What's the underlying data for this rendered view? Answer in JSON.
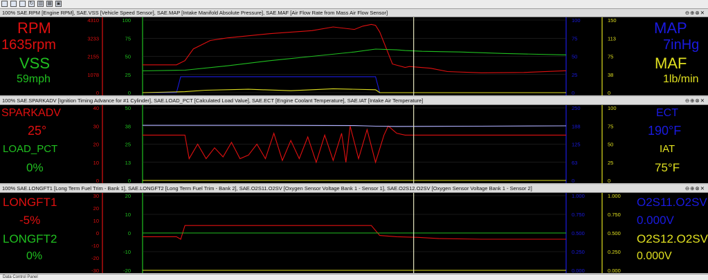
{
  "toolbar": {
    "icons": [
      "new-icon",
      "open-icon",
      "save-icon",
      "cycle-icon",
      "chart-icon",
      "grid-icon",
      "panel-icon"
    ]
  },
  "panels": [
    {
      "title": "100% SAE.RPM [Engine RPM], SAE.VSS [Vehicle Speed Sensor], SAE.MAP [Intake Manifold Absolute Pressure], SAE.MAF [Air Flow Rate from Mass Air Flow Sensor]",
      "controls": "⊖⊕⊗✕",
      "left": [
        {
          "text": "RPM",
          "color": "#e01010"
        },
        {
          "text": "1635rpm",
          "color": "#e01010"
        },
        {
          "text": "VSS",
          "color": "#20c020"
        },
        {
          "text": "59mph",
          "color": "#20c020"
        }
      ],
      "right": [
        {
          "text": "MAP",
          "color": "#1a1ae0"
        },
        {
          "text": "7inHg",
          "color": "#1a1ae0"
        },
        {
          "text": "MAF",
          "color": "#e0e020"
        },
        {
          "text": "1lb/min",
          "color": "#e0e020"
        }
      ]
    },
    {
      "title": "100% SAE.SPARKADV [Ignition Timing Advance for #1 Cylinder], SAE.LOAD_PCT [Calculated Load Value], SAE.ECT [Engine Coolant Temperature], SAE.IAT [Intake Air Temperature]",
      "controls": "⊖⊕⊗✕",
      "left": [
        {
          "text": "SPARKADV",
          "color": "#e01010"
        },
        {
          "text": "25°",
          "color": "#e01010"
        },
        {
          "text": "LOAD_PCT",
          "color": "#20c020"
        },
        {
          "text": "0%",
          "color": "#20c020"
        }
      ],
      "right": [
        {
          "text": "ECT",
          "color": "#1a1ae0"
        },
        {
          "text": "190°F",
          "color": "#1a1ae0"
        },
        {
          "text": "IAT",
          "color": "#e0e020"
        },
        {
          "text": "75°F",
          "color": "#e0e020"
        }
      ]
    },
    {
      "title": "100% SAE.LONGFT1 [Long Term Fuel Trim - Bank 1], SAE.LONGFT2 [Long Term Fuel Trim - Bank 2], SAE.O2S11.O2SV [Oxygen Sensor Voltage Bank 1 - Sensor 1], SAE.O2S12.O2SV [Oxygen Sensor Voltage Bank 1 - Sensor 2]",
      "controls": "⊖⊕⊗✕",
      "left": [
        {
          "text": "LONGFT1",
          "color": "#e01010"
        },
        {
          "text": "-5%",
          "color": "#e01010"
        },
        {
          "text": "LONGFT2",
          "color": "#20c020"
        },
        {
          "text": "0%",
          "color": "#20c020"
        }
      ],
      "right": [
        {
          "text": "O2S11.O2SV",
          "color": "#1a1ae0"
        },
        {
          "text": "0.000V",
          "color": "#1a1ae0"
        },
        {
          "text": "O2S12.O2SV",
          "color": "#e0e020"
        },
        {
          "text": "0.000V",
          "color": "#e0e020"
        }
      ]
    }
  ],
  "bottom_bar": {
    "label": "Data Control Panel"
  },
  "chart_data": [
    {
      "type": "line",
      "cursor_x": 64,
      "x_range": [
        0,
        100
      ],
      "axes": [
        {
          "side": "left-outer",
          "color": "#e01010",
          "ticks": [
            "0",
            "1078",
            "2155",
            "3233",
            "4310"
          ],
          "ylim": [
            0,
            4310
          ]
        },
        {
          "side": "left-inner",
          "color": "#20c020",
          "ticks": [
            "0",
            "25",
            "50",
            "75",
            "100"
          ],
          "ylim": [
            0,
            100
          ]
        },
        {
          "side": "right-inner",
          "color": "#1a1ae0",
          "ticks": [
            "0",
            "25",
            "50",
            "75",
            "100"
          ],
          "ylim": [
            0,
            100
          ]
        },
        {
          "side": "right-outer",
          "color": "#e0e020",
          "ticks": [
            "0",
            "38",
            "75",
            "113",
            "150"
          ],
          "ylim": [
            0,
            150
          ]
        }
      ],
      "series": [
        {
          "axis": 0,
          "color": "#e01010",
          "x": [
            0,
            8,
            10,
            12,
            16,
            20,
            30,
            40,
            45,
            50,
            52,
            54,
            55,
            56,
            59,
            62,
            63,
            68,
            72,
            80,
            90,
            100
          ],
          "y": [
            1650,
            1650,
            1900,
            2600,
            3100,
            3250,
            3500,
            3680,
            3900,
            3750,
            3950,
            4050,
            4000,
            3600,
            1700,
            1500,
            1550,
            1450,
            1250,
            1180,
            1200,
            1300
          ]
        },
        {
          "axis": 1,
          "color": "#20c020",
          "x": [
            0,
            10,
            20,
            30,
            40,
            50,
            55,
            60,
            62,
            66,
            75,
            85,
            100
          ],
          "y": [
            30,
            31,
            37,
            44,
            50,
            56,
            60,
            59,
            58,
            57,
            56,
            54,
            52
          ]
        },
        {
          "axis": 2,
          "color": "#1a1ae0",
          "x": [
            0,
            8,
            9,
            55,
            56,
            100
          ],
          "y": [
            0,
            0,
            22,
            22,
            0,
            0
          ]
        },
        {
          "axis": 3,
          "color": "#e0e020",
          "x": [
            0,
            10,
            15,
            25,
            35,
            45,
            55,
            56,
            100
          ],
          "y": [
            0,
            2,
            5,
            7,
            4,
            8,
            6,
            0,
            0
          ]
        }
      ]
    },
    {
      "type": "line",
      "cursor_x": 64,
      "x_range": [
        0,
        100
      ],
      "axes": [
        {
          "side": "left-outer",
          "color": "#e01010",
          "ticks": [
            "0",
            "10",
            "20",
            "30",
            "40"
          ],
          "ylim": [
            0,
            40
          ]
        },
        {
          "side": "left-inner",
          "color": "#20c020",
          "ticks": [
            "0",
            "13",
            "25",
            "38",
            "50"
          ],
          "ylim": [
            0,
            50
          ]
        },
        {
          "side": "right-inner",
          "color": "#1a1ae0",
          "ticks": [
            "0",
            "63",
            "125",
            "188",
            "250"
          ],
          "ylim": [
            0,
            250
          ]
        },
        {
          "side": "right-outer",
          "color": "#e0e020",
          "ticks": [
            "0",
            "25",
            "50",
            "75",
            "100"
          ],
          "ylim": [
            0,
            100
          ]
        }
      ],
      "series": [
        {
          "axis": 0,
          "color": "#e01010",
          "x": [
            0,
            8,
            10,
            11,
            13,
            15,
            17,
            19,
            21,
            23,
            25,
            27,
            29,
            31,
            33,
            35,
            37,
            39,
            41,
            43,
            45,
            47,
            48,
            49,
            51,
            53,
            55,
            57,
            58,
            60,
            62,
            64,
            66,
            70,
            80,
            90,
            100
          ],
          "y": [
            25,
            25,
            25,
            12,
            20,
            12,
            18,
            13,
            21,
            12,
            14,
            20,
            12,
            26,
            11,
            22,
            12,
            24,
            10,
            25,
            11,
            26,
            10,
            30,
            12,
            28,
            10,
            25,
            30,
            26,
            25,
            25,
            25,
            25,
            25,
            25,
            25
          ]
        },
        {
          "axis": 1,
          "color": "#20c020",
          "x": [
            0,
            100
          ],
          "y": [
            0,
            0
          ]
        },
        {
          "axis": 2,
          "color": "#b0b0ff",
          "x": [
            0,
            30,
            50,
            55,
            60,
            80,
            100
          ],
          "y": [
            190,
            190,
            189,
            187,
            186,
            187,
            188
          ]
        },
        {
          "axis": 3,
          "color": "#e0e020",
          "x": [
            0,
            100
          ],
          "y": [
            0,
            0
          ]
        }
      ]
    },
    {
      "type": "line",
      "cursor_x": 64,
      "x_range": [
        0,
        100
      ],
      "axes": [
        {
          "side": "left-outer",
          "color": "#e01010",
          "ticks": [
            "-30",
            "-20",
            "-10",
            "0",
            "10",
            "20",
            "30"
          ],
          "ylim": [
            -30,
            30
          ]
        },
        {
          "side": "left-inner",
          "color": "#20c020",
          "ticks": [
            "-20",
            "-10",
            "0",
            "10",
            "20"
          ],
          "ylim": [
            -20,
            20
          ]
        },
        {
          "side": "right-inner",
          "color": "#1a1ae0",
          "ticks": [
            "0.000",
            "0.250",
            "0.500",
            "0.750",
            "1.000"
          ],
          "ylim": [
            0,
            1
          ]
        },
        {
          "side": "right-outer",
          "color": "#e0e020",
          "ticks": [
            "0.000",
            "0.250",
            "0.500",
            "0.750",
            "1.000"
          ],
          "ylim": [
            0,
            1
          ]
        }
      ],
      "series": [
        {
          "axis": 0,
          "color": "#e01010",
          "x": [
            0,
            8,
            9,
            10,
            20,
            40,
            54,
            56,
            60,
            65,
            70,
            80,
            100
          ],
          "y": [
            -3,
            -3,
            -5,
            6,
            6,
            6,
            6,
            -2,
            -3,
            -3.5,
            -4.5,
            -5,
            -5
          ]
        },
        {
          "axis": 1,
          "color": "#20c020",
          "x": [
            0,
            100
          ],
          "y": [
            0,
            0
          ]
        },
        {
          "axis": 2,
          "color": "#1a1ae0",
          "x": [
            0,
            100
          ],
          "y": [
            0,
            0
          ]
        },
        {
          "axis": 3,
          "color": "#e0e020",
          "x": [
            0,
            100
          ],
          "y": [
            0,
            0
          ]
        }
      ]
    }
  ]
}
